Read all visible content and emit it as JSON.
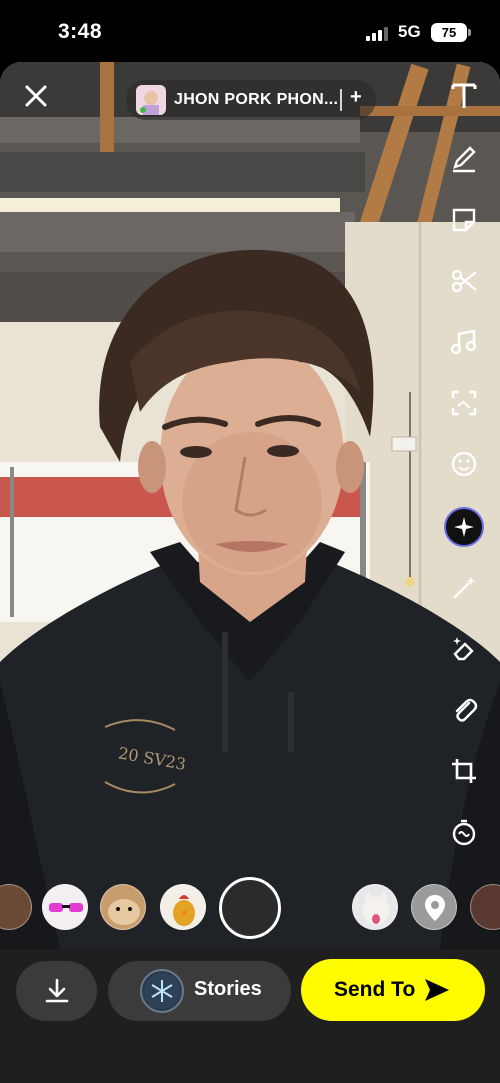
{
  "status_bar": {
    "time": "3:48",
    "network": "5G",
    "battery": "75"
  },
  "top": {
    "recipient_name": "JHON PORK PHON...",
    "add_label": "+"
  },
  "tools": [
    {
      "name": "text-tool-icon"
    },
    {
      "name": "draw-tool-icon"
    },
    {
      "name": "sticker-tool-icon"
    },
    {
      "name": "scissors-tool-icon"
    },
    {
      "name": "music-tool-icon"
    },
    {
      "name": "scan-tool-icon"
    },
    {
      "name": "emoji-tool-icon"
    },
    {
      "name": "ai-sparkle-tool-icon"
    },
    {
      "name": "magic-wand-tool-icon"
    },
    {
      "name": "eraser-tool-icon"
    },
    {
      "name": "attachment-tool-icon"
    },
    {
      "name": "crop-tool-icon"
    },
    {
      "name": "timer-tool-icon"
    }
  ],
  "bottom": {
    "stories_label": "Stories",
    "send_label": "Send To"
  },
  "colors": {
    "accent_yellow": "#fffc00",
    "bar_bg": "#1f1f1f",
    "button_bg": "#3b3b3b"
  }
}
